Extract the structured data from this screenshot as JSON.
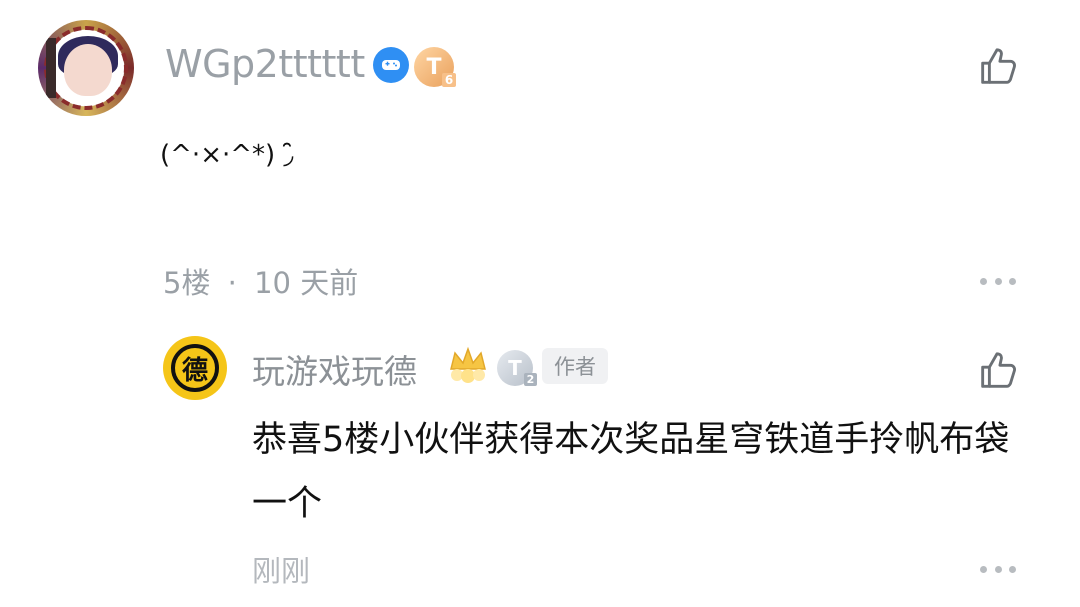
{
  "comment": {
    "username": "WGp2tttttt",
    "level_badge": "T",
    "level_sub": "6",
    "text": "(^·×·^*) ◞̑̑",
    "floor": "5楼",
    "separator": "·",
    "time": "10 天前",
    "icons": {
      "game_badge": "gamepad-icon",
      "like": "thumbs-up-icon",
      "more": "more-dots-icon"
    }
  },
  "reply": {
    "avatar_char": "德",
    "username": "玩游戏玩德",
    "level_badge": "T",
    "level_sub": "2",
    "author_tag": "作者",
    "text": "恭喜5楼小伙伴获得本次奖品星穹铁道手拎帆布袋一个",
    "time": "刚刚",
    "icons": {
      "crown": "crown-icon",
      "like": "thumbs-up-icon",
      "more": "more-dots-icon"
    }
  },
  "colors": {
    "muted_text": "#9aa0a6",
    "game_badge": "#2f8ff3",
    "avatar_yellow": "#f5c518"
  }
}
